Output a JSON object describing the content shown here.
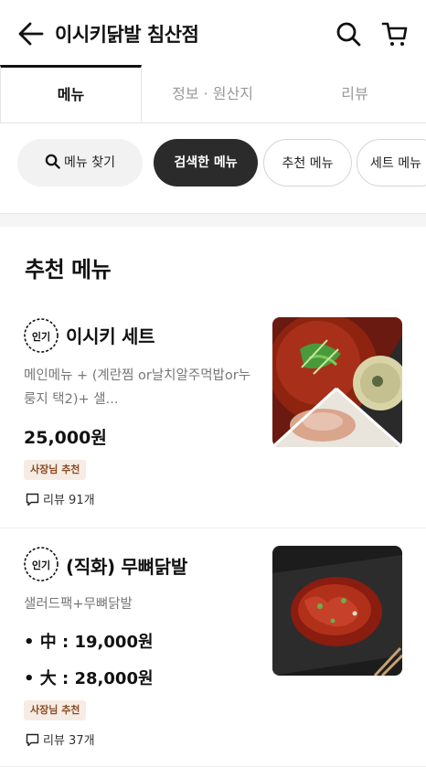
{
  "header": {
    "title": "이시키닭발 침산점",
    "back_icon": "arrow-left-icon",
    "search_icon": "search-icon",
    "cart_icon": "cart-icon"
  },
  "tabs": [
    {
      "label": "메뉴",
      "active": true
    },
    {
      "label": "정보 · 원산지"
    },
    {
      "label": "리뷰"
    }
  ],
  "chips": {
    "search": "메뉴 찾기",
    "searched": "검색한 메뉴",
    "recommended": "추천 메뉴",
    "set": "세트 메뉴"
  },
  "section": {
    "title": "추천 메뉴"
  },
  "items": [
    {
      "badge": "인기",
      "name": "이시키 세트",
      "desc": "메인메뉴 + (계란찜 or날치알주먹밥or누룽지 택2)+ 샐...",
      "price": "25,000원",
      "tag": "사장님 추천",
      "review": "리뷰 91개"
    },
    {
      "badge": "인기",
      "name": "(직화) 무뼈닭발",
      "desc": "샐러드팩+무뼈닭발",
      "price_mid": "• 中 : 19,000원",
      "price_large": "• 大 : 28,000원",
      "tag": "사장님 추천",
      "review": "리뷰 37개"
    }
  ],
  "colors": {
    "accent_dark": "#2b2b2b",
    "tag_bg": "#f6ece4",
    "tag_text": "#8a4b24"
  }
}
